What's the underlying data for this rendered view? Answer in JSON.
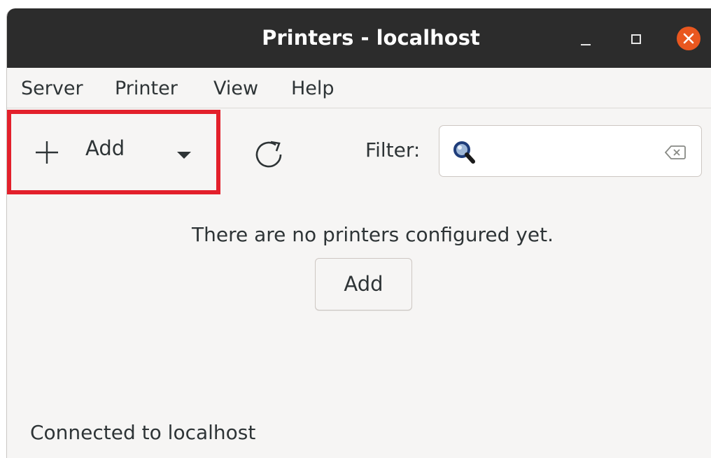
{
  "window": {
    "title": "Printers - localhost"
  },
  "menubar": {
    "items": [
      "Server",
      "Printer",
      "View",
      "Help"
    ]
  },
  "toolbar": {
    "add_label": "Add",
    "filter_label": "Filter:",
    "filter_value": "",
    "icons": {
      "add": "plus-icon",
      "add_menu": "chevron-down-icon",
      "refresh": "refresh-icon",
      "search": "search-icon",
      "clear": "backspace-icon"
    }
  },
  "main": {
    "empty_message": "There are no printers configured yet.",
    "add_button_label": "Add"
  },
  "statusbar": {
    "text": "Connected to localhost"
  },
  "colors": {
    "titlebar": "#2c2c2c",
    "close_button": "#e9571f",
    "highlight_box": "#e3202b",
    "window_bg": "#f6f5f4"
  }
}
